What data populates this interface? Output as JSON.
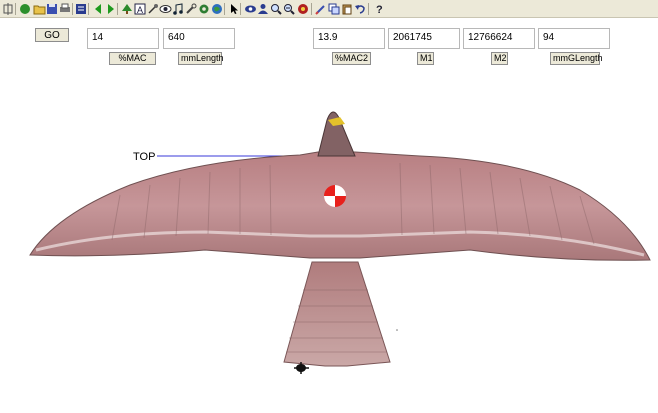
{
  "go_label": "GO",
  "fields": [
    {
      "value": "14",
      "label": "%MAC"
    },
    {
      "value": "640",
      "label": "mmLength"
    },
    {
      "value": "13.9",
      "label": "%MAC2"
    },
    {
      "value": "2061745",
      "label": "M1"
    },
    {
      "value": "12766624",
      "label": "M2"
    },
    {
      "value": "94",
      "label": "mmGLength"
    }
  ],
  "top_label": "TOP",
  "toolbar_icons": [
    "settings-icon",
    "open-folder-icon",
    "save-icon",
    "print-icon",
    "list-icon",
    "arrow-left-icon",
    "arrow-right-icon",
    "tree-icon",
    "a-box-icon",
    "eye-icon",
    "eye-icon",
    "music-note-icon",
    "tool-icon",
    "gear-icon",
    "globe-icon",
    "pointer-icon",
    "eye-icon",
    "person-icon",
    "zoom-in-icon",
    "zoom-out-icon",
    "stop-icon",
    "pencil-icon",
    "copy-icon",
    "paste-icon",
    "undo-icon",
    "help-icon"
  ],
  "colors": {
    "marker": "#e8201c",
    "top_line": "#3a3ad8",
    "bird": "#b68384"
  }
}
